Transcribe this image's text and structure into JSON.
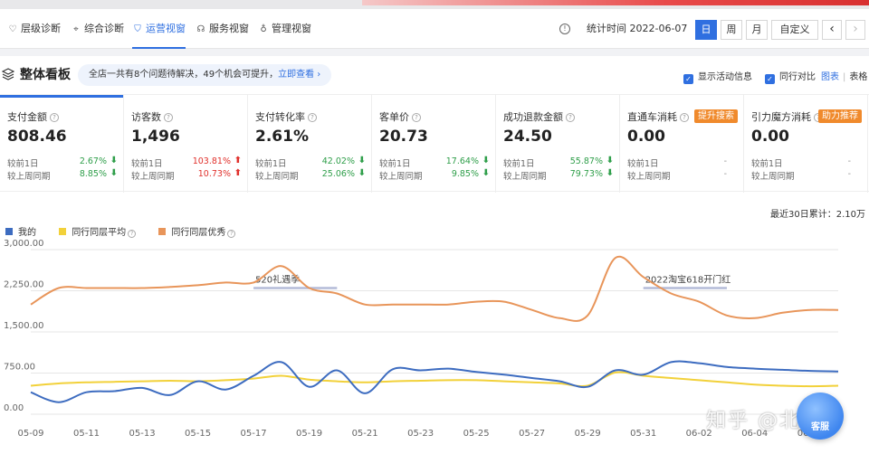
{
  "nav": {
    "tabs": [
      {
        "label": "层级诊断",
        "icon": "heart-icon"
      },
      {
        "label": "综合诊断",
        "icon": "crosshair-icon"
      },
      {
        "label": "运营视窗",
        "icon": "shield-icon",
        "active": true
      },
      {
        "label": "服务视窗",
        "icon": "headset-icon"
      },
      {
        "label": "管理视窗",
        "icon": "medal-icon"
      }
    ],
    "stat_time_label": "统计时间 2022-06-07",
    "range_buttons": [
      "日",
      "周",
      "月",
      "自定义"
    ],
    "active_range": "日",
    "prev_glyph": "‹",
    "next_glyph": "›"
  },
  "board": {
    "title": "整体看板",
    "banner_text": "全店一共有8个问题待解决，49个机会可提升，",
    "banner_link": "立即查看 ›",
    "show_activity_label": "显示活动信息",
    "peer_compare_label": "同行对比",
    "view_chart_label": "图表",
    "view_table_label": "表格"
  },
  "cards": [
    {
      "name": "支付金额",
      "value": "808.46",
      "d1_label": "较前1日",
      "d1": "2.67%",
      "d1_dir": "down",
      "w_label": "较上周同期",
      "w": "8.85%",
      "w_dir": "down"
    },
    {
      "name": "访客数",
      "value": "1,496",
      "d1_label": "较前1日",
      "d1": "103.81%",
      "d1_dir": "up",
      "w_label": "较上周同期",
      "w": "10.73%",
      "w_dir": "up"
    },
    {
      "name": "支付转化率",
      "value": "2.61%",
      "d1_label": "较前1日",
      "d1": "42.02%",
      "d1_dir": "down",
      "w_label": "较上周同期",
      "w": "25.06%",
      "w_dir": "down"
    },
    {
      "name": "客单价",
      "value": "20.73",
      "d1_label": "较前1日",
      "d1": "17.64%",
      "d1_dir": "down",
      "w_label": "较上周同期",
      "w": "9.85%",
      "w_dir": "down"
    },
    {
      "name": "成功退款金额",
      "value": "24.50",
      "d1_label": "较前1日",
      "d1": "55.87%",
      "d1_dir": "down",
      "w_label": "较上周同期",
      "w": "79.73%",
      "w_dir": "down"
    },
    {
      "name": "直通车消耗",
      "value": "0.00",
      "tag": "提升搜索",
      "d1_label": "较前1日",
      "d1": "-",
      "d1_dir": "none",
      "w_label": "较上周同期",
      "w": "-",
      "w_dir": "none"
    },
    {
      "name": "引力魔方消耗",
      "value": "0.00",
      "tag": "助力推荐",
      "d1_label": "较前1日",
      "d1": "-",
      "d1_dir": "none",
      "w_label": "较上周同期",
      "w": "-",
      "w_dir": "none"
    }
  ],
  "summary": "最近30日累计：2.10万",
  "colors": {
    "accent": "#2f6fe0",
    "mine": "#3d6cc0",
    "peer_avg": "#f2d13a",
    "peer_top": "#e8955a",
    "up": "#e0302b",
    "down": "#2e9e49"
  },
  "chart_data": {
    "type": "line",
    "title": "",
    "xlabel": "",
    "ylabel": "",
    "ylim": [
      0,
      3000
    ],
    "yticks": [
      "0.00",
      "750.00",
      "1,500.00",
      "2,250.00",
      "3,000.00"
    ],
    "ytick_values": [
      0,
      750,
      1500,
      2250,
      3000
    ],
    "x": [
      "05-09",
      "05-10",
      "05-11",
      "05-12",
      "05-13",
      "05-14",
      "05-15",
      "05-16",
      "05-17",
      "05-18",
      "05-19",
      "05-20",
      "05-21",
      "05-22",
      "05-23",
      "05-24",
      "05-25",
      "05-26",
      "05-27",
      "05-28",
      "05-29",
      "05-30",
      "05-31",
      "06-01",
      "06-02",
      "06-03",
      "06-04",
      "06-05",
      "06-06",
      "06-07"
    ],
    "xtick_labels": [
      "05-09",
      "05-11",
      "05-13",
      "05-15",
      "05-17",
      "05-19",
      "05-21",
      "05-23",
      "05-25",
      "05-27",
      "05-29",
      "05-31",
      "06-02",
      "06-04",
      "06-07"
    ],
    "xtick_positions": [
      "05-09",
      "05-11",
      "05-13",
      "05-15",
      "05-17",
      "05-19",
      "05-21",
      "05-23",
      "05-25",
      "05-27",
      "05-29",
      "05-31",
      "06-02",
      "06-04",
      "06-06"
    ],
    "legend": "top-left",
    "series": [
      {
        "name": "我的",
        "values": [
          400,
          220,
          400,
          420,
          480,
          350,
          600,
          450,
          700,
          950,
          500,
          800,
          380,
          820,
          800,
          830,
          770,
          720,
          660,
          600,
          500,
          800,
          720,
          950,
          930,
          860,
          830,
          810,
          790,
          780
        ]
      },
      {
        "name": "同行同层平均",
        "values": [
          520,
          560,
          580,
          590,
          600,
          610,
          600,
          620,
          650,
          700,
          630,
          600,
          580,
          600,
          610,
          620,
          620,
          600,
          580,
          560,
          520,
          760,
          700,
          660,
          620,
          580,
          540,
          520,
          510,
          520
        ]
      },
      {
        "name": "同行同层优秀",
        "values": [
          2000,
          2300,
          2300,
          2300,
          2300,
          2320,
          2350,
          2400,
          2400,
          2700,
          2300,
          2200,
          2000,
          2000,
          2000,
          2000,
          2050,
          2050,
          1900,
          1750,
          1800,
          2850,
          2500,
          2200,
          2050,
          1800,
          1750,
          1850,
          1900,
          1900
        ]
      }
    ],
    "annotations": [
      {
        "label": "520礼遇季",
        "from": "05-17",
        "to": "05-20"
      },
      {
        "label": "2022淘宝618开门红",
        "from": "05-31",
        "to": "06-03"
      }
    ]
  },
  "watermark": "知乎 @北松",
  "float_button": "客服"
}
